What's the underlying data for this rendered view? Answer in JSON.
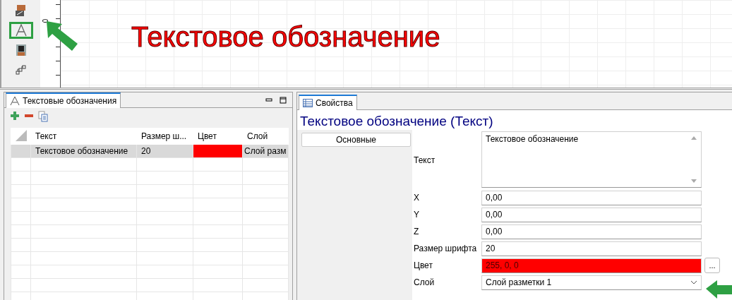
{
  "canvas": {
    "ruler_label": "0",
    "caption": "Текстовое обозначение"
  },
  "toolbar": {
    "tools": [
      {
        "kind": "layer",
        "selected": false
      },
      {
        "kind": "text",
        "selected": true
      },
      {
        "kind": "block",
        "selected": false
      },
      {
        "kind": "steps",
        "selected": false
      }
    ]
  },
  "list_panel": {
    "tab": {
      "label": "Текстовые обозначения",
      "selected": true
    },
    "table": {
      "columns": [
        "Текст",
        "Размер ш...",
        "Цвет",
        "Слой"
      ],
      "rows": [
        {
          "selected": true,
          "text": "Текстовое обозначение",
          "size": "20",
          "color": "#ff0000",
          "layer": "Слой разм"
        }
      ]
    }
  },
  "properties_panel": {
    "tab": {
      "label": "Свойства",
      "selected": true
    },
    "heading": "Текстовое обозначение (Текст)",
    "section": "Основные",
    "fields": [
      {
        "kind": "textarea",
        "label": "Текст",
        "value": "Текстовое обозначение"
      },
      {
        "kind": "input",
        "label": "X",
        "value": "0,00"
      },
      {
        "kind": "input",
        "label": "Y",
        "value": "0,00"
      },
      {
        "kind": "input",
        "label": "Z",
        "value": "0,00"
      },
      {
        "kind": "input",
        "label": "Размер шрифта",
        "value": "20"
      },
      {
        "kind": "color",
        "label": "Цвет",
        "value": "255, 0, 0",
        "color": "#ff0000",
        "button": "..."
      },
      {
        "kind": "select",
        "label": "Слой",
        "value": "Слой разметки 1"
      }
    ]
  }
}
